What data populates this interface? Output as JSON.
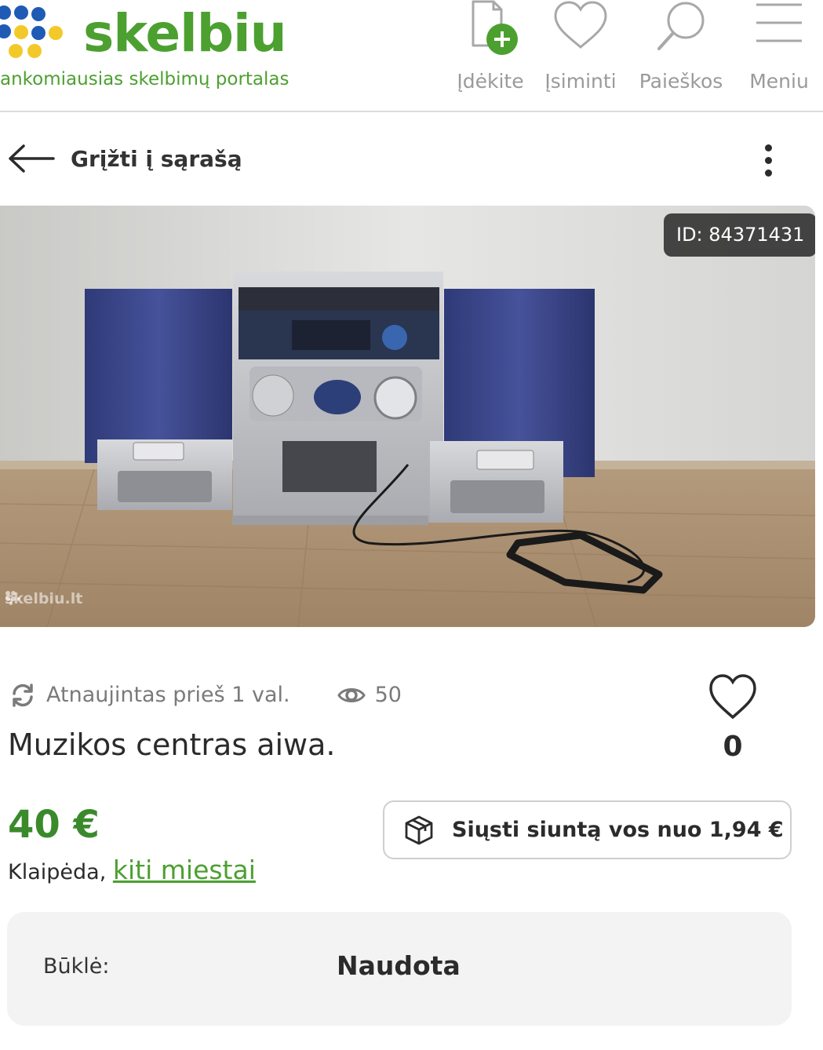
{
  "header": {
    "logo_text": "skelbiu",
    "tagline": "ankomiausias skelbimų portalas",
    "nav": [
      {
        "label": "Įdėkite",
        "icon": "add-document-icon"
      },
      {
        "label": "Įsiminti",
        "icon": "heart-icon"
      },
      {
        "label": "Paieškos",
        "icon": "search-icon"
      },
      {
        "label": "Meniu",
        "icon": "menu-icon"
      }
    ],
    "colors": {
      "brand_green": "#4ca030",
      "dot_blue": "#1f5bb5",
      "dot_yellow": "#f3c92a"
    }
  },
  "back": {
    "label": "Grįžti į sąrašą"
  },
  "listing": {
    "id_badge": "ID: 84371431",
    "watermark": "skelbiu.lt",
    "updated": "Atnaujintas prieš 1 val.",
    "views": "50",
    "title": "Muzikos centras aiwa.",
    "favorites_count": "0",
    "price": "40 €",
    "city": "Klaipėda,",
    "other_cities_link": "kiti miestai",
    "shipping_button": "Siųsti siuntą vos nuo 1,94 €",
    "condition_label": "Būklė:",
    "condition_value": "Naudota"
  }
}
